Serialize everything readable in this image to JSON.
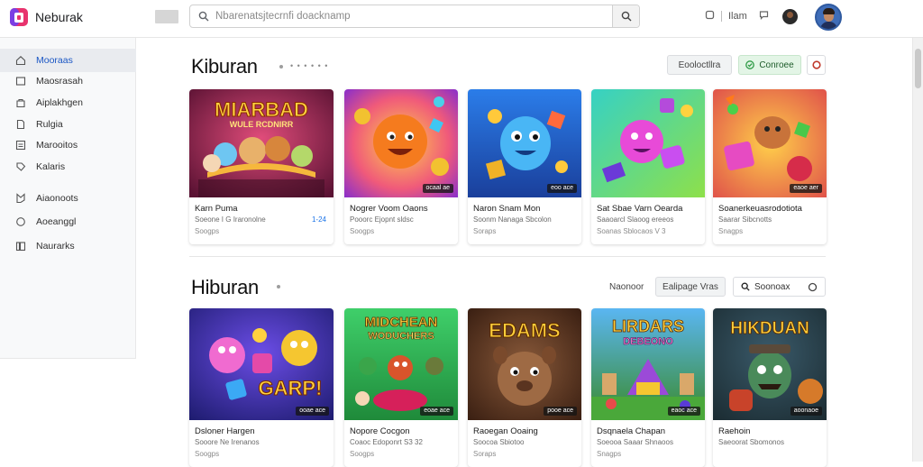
{
  "app": {
    "brand": "Neburak",
    "logo_icon": "app-logo-icon"
  },
  "search": {
    "placeholder": "Nbarenatsjtecrnfi doacknamp"
  },
  "topbar": {
    "user_label": "Ilam"
  },
  "sidebar": {
    "items": [
      {
        "label": "Mooraas",
        "icon": "home-icon",
        "active": true
      },
      {
        "label": "Maosrasah",
        "icon": "square-icon",
        "active": false
      },
      {
        "label": "Aiplakhgen",
        "icon": "bag-icon",
        "active": false
      },
      {
        "label": "Rulgia",
        "icon": "document-icon",
        "active": false
      },
      {
        "label": "Marooitos",
        "icon": "list-icon",
        "active": false
      },
      {
        "label": "Kalaris",
        "icon": "tag-icon",
        "active": false
      },
      {
        "label": "Aiaonoots",
        "icon": "flag-icon",
        "active": false
      },
      {
        "label": "Aoeanggl",
        "icon": "circle-icon",
        "active": false
      },
      {
        "label": "Naurarks",
        "icon": "library-icon",
        "active": false
      }
    ]
  },
  "section1": {
    "title": "Kiburan",
    "meta": "• • • • • •",
    "buttons": {
      "gray": "Eooloctllra",
      "green": "Conroee"
    },
    "cards": [
      {
        "title": "Karn Puma",
        "subtitle": "Soeone I G Iraronolne",
        "meta": "Soogps",
        "rating": "1-24",
        "badge": ""
      },
      {
        "title": "Nogrer Voom Oaons",
        "subtitle": "Pooorc  Ejopnt  sldsc",
        "meta": "Soogps",
        "rating": "",
        "badge": "ocaal ae"
      },
      {
        "title": "Naron Snam Mon",
        "subtitle": "Soonm Nanaga Sbcolon",
        "meta": "Soraps",
        "rating": "",
        "badge": "eoo ace"
      },
      {
        "title": "Sat Sbae Varn Oearda",
        "subtitle": "Saaoarcl Slaoog ereeos",
        "meta": "Soanas  Sblocaos  V 3",
        "rating": "",
        "badge": ""
      },
      {
        "title": "Soanerkeuasrodotiota",
        "subtitle": "Saarar  Sibcnotts",
        "meta": "Snagps",
        "rating": "",
        "badge": "eaoe aer"
      }
    ]
  },
  "section2": {
    "title": "Hiburan",
    "buttons": {
      "label": "Naonoor",
      "lang": "Ealipage Vras",
      "search": "Soonoax"
    },
    "cards": [
      {
        "title": "Dsloner Hargen",
        "subtitle": "Sooore Ne Irenanos",
        "meta": "Soogps",
        "badge": "ooae ace"
      },
      {
        "title": "Nopore Cocgon",
        "subtitle": "Coaoc  Edoponrt  S3 32",
        "meta": "Soogps",
        "badge": "eoae ace"
      },
      {
        "title": "Raoegan Ooaing",
        "subtitle": "Soocoa  Sbiotoo",
        "meta": "Soraps",
        "badge": "pooe ace"
      },
      {
        "title": "Dsqnaela Chapan",
        "subtitle": "Soeooa  Saaar  Shnaoos",
        "meta": "Snagps",
        "badge": "eaoc ace"
      },
      {
        "title": "Raehoin",
        "subtitle": "Saeoorat  Sbomonos",
        "meta": "",
        "badge": "aoonaoe"
      }
    ]
  },
  "art": {
    "s1c1": "MIARBAD",
    "s1c1b": "WULE RCDNIRR",
    "s2c1": "GARP!",
    "s2c2": "MIDCHEAN",
    "s2c2b": "WODUCHERS",
    "s2c3": "EDAMS",
    "s2c4": "LIRDARS",
    "s2c4b": "DEBEONO",
    "s2c5": "HIKDUAN"
  },
  "colors": {
    "accent": "#1a56c4",
    "green": "#2e9b45",
    "red": "#c0392b"
  }
}
